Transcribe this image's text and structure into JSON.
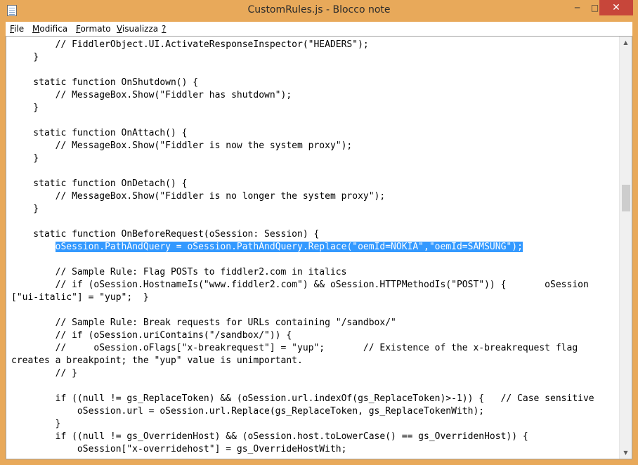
{
  "window": {
    "title": "CustomRules.js - Blocco note",
    "icon": "notepad-icon",
    "controls": {
      "minimize": "─",
      "maximize": "□",
      "close": "✕"
    }
  },
  "menu": {
    "items": [
      {
        "accel": "F",
        "rest": "ile"
      },
      {
        "accel": "M",
        "rest": "odifica"
      },
      {
        "accel": "F",
        "rest": "ormato"
      },
      {
        "accel": "V",
        "rest": "isualizza"
      },
      {
        "accel": "?",
        "rest": ""
      }
    ]
  },
  "editor": {
    "lines": [
      "        // FiddlerObject.UI.ActivateResponseInspector(\"HEADERS\");",
      "    }",
      "",
      "    static function OnShutdown() {",
      "        // MessageBox.Show(\"Fiddler has shutdown\");",
      "    }",
      "",
      "    static function OnAttach() {",
      "        // MessageBox.Show(\"Fiddler is now the system proxy\");",
      "    }",
      "",
      "    static function OnDetach() {",
      "        // MessageBox.Show(\"Fiddler is no longer the system proxy\");",
      "    }",
      "",
      "    static function OnBeforeRequest(oSession: Session) {",
      "SELECTED",
      "",
      "        // Sample Rule: Flag POSTs to fiddler2.com in italics",
      "        // if (oSession.HostnameIs(\"www.fiddler2.com\") && oSession.HTTPMethodIs(\"POST\")) {       oSession",
      "[\"ui-italic\"] = \"yup\";  }",
      "",
      "        // Sample Rule: Break requests for URLs containing \"/sandbox/\"",
      "        // if (oSession.uriContains(\"/sandbox/\")) {",
      "        //     oSession.oFlags[\"x-breakrequest\"] = \"yup\";       // Existence of the x-breakrequest flag",
      "creates a breakpoint; the \"yup\" value is unimportant.",
      "        // }",
      "",
      "        if ((null != gs_ReplaceToken) && (oSession.url.indexOf(gs_ReplaceToken)>-1)) {   // Case sensitive",
      "            oSession.url = oSession.url.Replace(gs_ReplaceToken, gs_ReplaceTokenWith);",
      "        }",
      "        if ((null != gs_OverridenHost) && (oSession.host.toLowerCase() == gs_OverridenHost)) {",
      "            oSession[\"x-overridehost\"] = gs_OverrideHostWith;"
    ],
    "selected_indent": "        ",
    "selected_text": "oSession.PathAndQuery = oSession.PathAndQuery.Replace(\"oemId=NOKIA\",\"oemId=SAMSUNG\");"
  },
  "scrollbar": {
    "up": "▲",
    "down": "▼"
  }
}
